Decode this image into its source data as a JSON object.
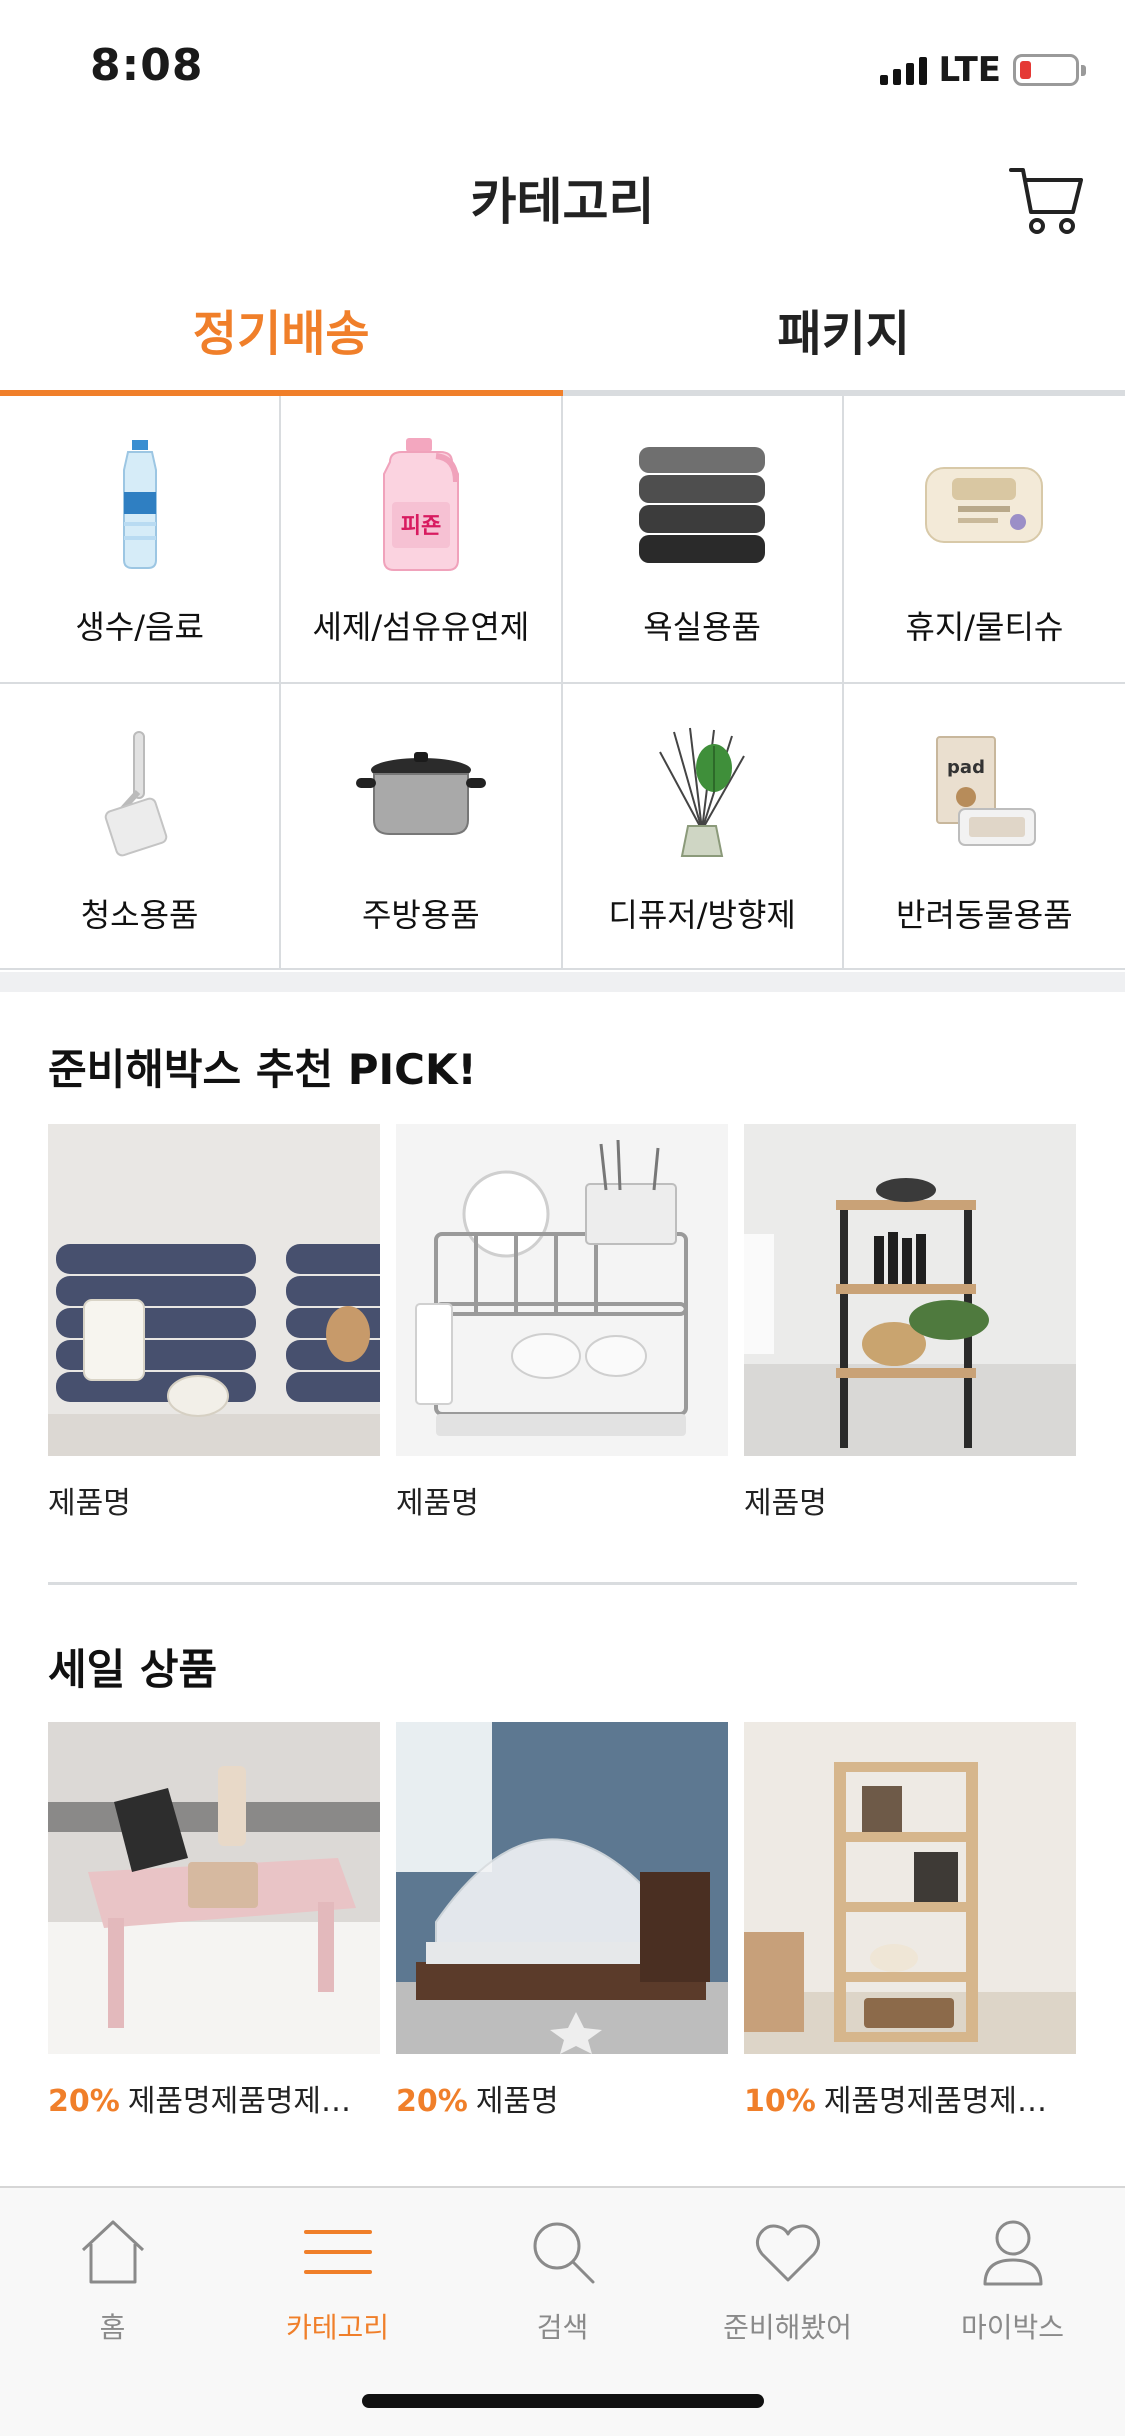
{
  "status_bar": {
    "time": "8:08",
    "network": "LTE"
  },
  "header": {
    "title": "카테고리"
  },
  "tabs": [
    {
      "label": "정기배송",
      "active": true
    },
    {
      "label": "패키지",
      "active": false
    }
  ],
  "categories": [
    {
      "label": "생수/음료",
      "icon": "water-bottle-icon"
    },
    {
      "label": "세제/섬유유연제",
      "icon": "detergent-bottle-icon"
    },
    {
      "label": "욕실용품",
      "icon": "towel-stack-icon"
    },
    {
      "label": "휴지/물티슈",
      "icon": "wet-wipes-icon"
    },
    {
      "label": "청소용품",
      "icon": "lint-roller-icon"
    },
    {
      "label": "주방용품",
      "icon": "cooking-pot-icon"
    },
    {
      "label": "디퓨저/방향제",
      "icon": "diffuser-icon"
    },
    {
      "label": "반려동물용품",
      "icon": "pet-supplies-icon"
    }
  ],
  "recommend": {
    "title": "준비해박스 추천 PICK!",
    "items": [
      {
        "name": "제품명",
        "image": "towel-product-image"
      },
      {
        "name": "제품명",
        "image": "dish-rack-product-image"
      },
      {
        "name": "제품명",
        "image": "shelf-product-image"
      }
    ]
  },
  "sale": {
    "title": "세일 상품",
    "items": [
      {
        "discount": "20%",
        "name": "제품명제품명제…",
        "image": "lap-desk-product-image"
      },
      {
        "discount": "20%",
        "name": "제품명",
        "image": "mosquito-net-product-image"
      },
      {
        "discount": "10%",
        "name": "제품명제품명제…",
        "image": "wood-shelf-product-image"
      }
    ]
  },
  "bottom_nav": [
    {
      "label": "홈",
      "icon": "home-icon",
      "active": false
    },
    {
      "label": "카테고리",
      "icon": "menu-icon",
      "active": true
    },
    {
      "label": "검색",
      "icon": "search-icon",
      "active": false
    },
    {
      "label": "준비해봤어",
      "icon": "heart-icon",
      "active": false
    },
    {
      "label": "마이박스",
      "icon": "user-icon",
      "active": false
    }
  ],
  "colors": {
    "accent": "#f07f2a",
    "divider": "#d9dcdf",
    "text": "#1a1a1a",
    "muted": "#8a8a8a"
  }
}
